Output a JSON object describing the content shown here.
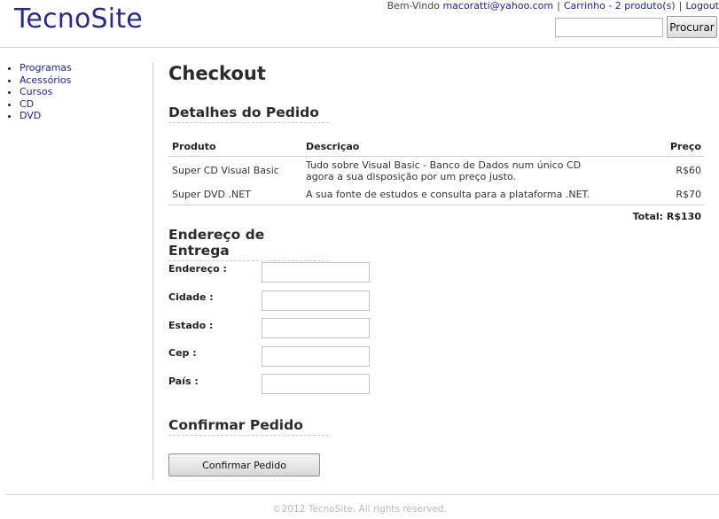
{
  "header": {
    "logo": "TecnoSite",
    "welcome": "Bem-Vindo",
    "email": "macoratti@yahoo.com",
    "cart": "Carrinho - 2 produto(s)",
    "logout": "Logout",
    "separator": "|",
    "search_value": "",
    "search_button": "Procurar"
  },
  "sidebar": {
    "items": [
      {
        "label": "Programas"
      },
      {
        "label": "Acessórios"
      },
      {
        "label": "Cursos"
      },
      {
        "label": "CD"
      },
      {
        "label": "DVD"
      }
    ]
  },
  "main": {
    "title": "Checkout",
    "order": {
      "title": "Detalhes do Pedido",
      "columns": [
        "Produto",
        "Descriçao",
        "Preço"
      ],
      "rows": [
        {
          "product": "Super CD Visual Basic",
          "description_line1": "Tudo sobre Visual Basic - Banco de Dados num único CD",
          "description_line2": "agora a sua disposição por um preço justo.",
          "price": "R$60"
        },
        {
          "product": "Super DVD .NET",
          "description_line1": "A sua fonte de estudos e consulta para a plataforma .NET.",
          "price": "R$70"
        }
      ],
      "total": "Total: R$130"
    },
    "address": {
      "title": "Endereço de Entrega",
      "fields": [
        {
          "label": "Endereço :",
          "value": ""
        },
        {
          "label": "Cidade :",
          "value": ""
        },
        {
          "label": "Estado :",
          "value": ""
        },
        {
          "label": "Cep :",
          "value": ""
        },
        {
          "label": "País :",
          "value": ""
        }
      ]
    },
    "confirm": {
      "title": "Confirmar Pedido",
      "button": "Confirmar Pedido"
    }
  },
  "footer": {
    "text": "©2012 TecnoSite. All rights reserved."
  }
}
